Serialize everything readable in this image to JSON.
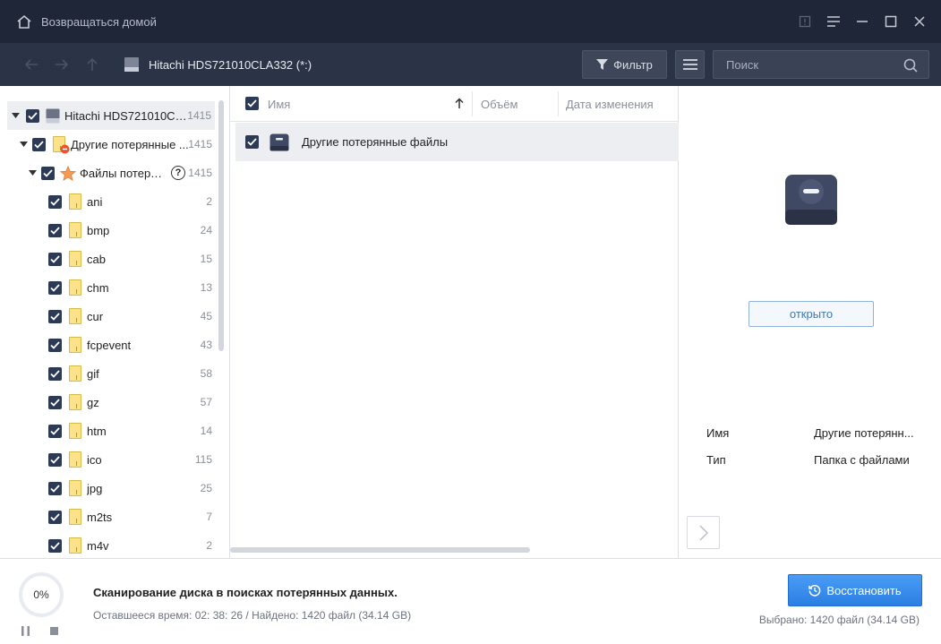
{
  "titlebar": {
    "home_label": "Возвращаться домой"
  },
  "navbar": {
    "path_label": "Hitachi HDS721010CLA332 (*:)",
    "filter_label": "Фильтр",
    "search_placeholder": "Поиск"
  },
  "tree": {
    "root": {
      "label": "Hitachi HDS721010CLA...",
      "count": "1415"
    },
    "lost": {
      "label": "Другие потерянные ...",
      "count": "1415"
    },
    "lostfiles": {
      "label": "Файлы потеря...",
      "count": "1415"
    },
    "items": [
      {
        "label": "ani",
        "count": "2"
      },
      {
        "label": "bmp",
        "count": "24"
      },
      {
        "label": "cab",
        "count": "15"
      },
      {
        "label": "chm",
        "count": "13"
      },
      {
        "label": "cur",
        "count": "45"
      },
      {
        "label": "fcpevent",
        "count": "43"
      },
      {
        "label": "gif",
        "count": "58"
      },
      {
        "label": "gz",
        "count": "57"
      },
      {
        "label": "htm",
        "count": "14"
      },
      {
        "label": "ico",
        "count": "115"
      },
      {
        "label": "jpg",
        "count": "25"
      },
      {
        "label": "m2ts",
        "count": "7"
      },
      {
        "label": "m4v",
        "count": "2"
      }
    ]
  },
  "filelist": {
    "col_name": "Имя",
    "col_size": "Объём",
    "col_date": "Дата изменения",
    "rows": [
      {
        "name": "Другие потерянные файлы"
      }
    ]
  },
  "preview": {
    "open_label": "открыто",
    "prop_name_label": "Имя",
    "prop_name_value": "Другие потерянн...",
    "prop_type_label": "Тип",
    "prop_type_value": "Папка с файлами"
  },
  "bottom": {
    "progress": "0%",
    "scan_title": "Сканирование диска в поисках потерянных данных.",
    "scan_sub": "Оставшееся время: 02: 38: 26 / Найдено: 1420 файл (34.14 GB)",
    "recover_label": "Восстановить",
    "selected_info": "Выбрано: 1420 файл (34.14 GB)"
  }
}
